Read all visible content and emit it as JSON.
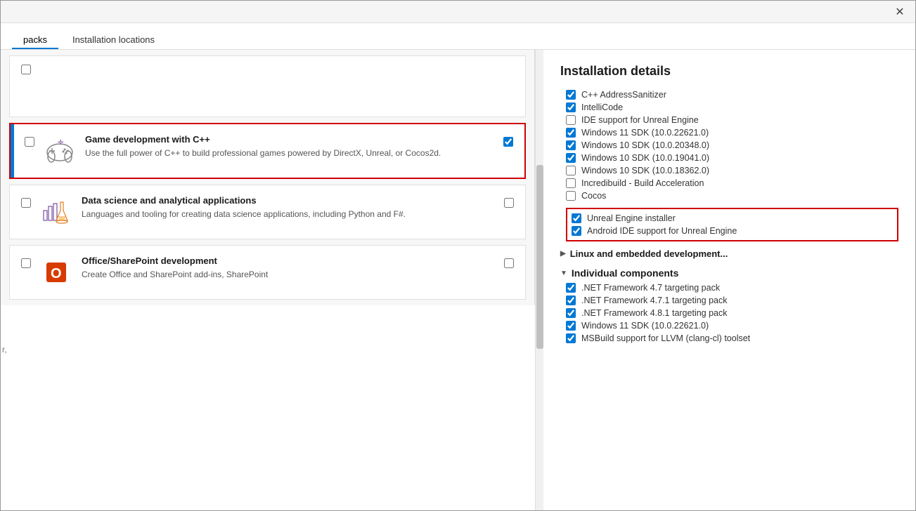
{
  "window": {
    "close_label": "✕"
  },
  "tabs": [
    {
      "id": "workloads",
      "label": "packs"
    },
    {
      "id": "locations",
      "label": "Installation locations"
    }
  ],
  "left_panel": {
    "items": [
      {
        "id": "empty-top",
        "type": "empty"
      },
      {
        "id": "game-dev",
        "type": "workload",
        "selected": true,
        "checked": true,
        "icon": "gamepad",
        "title": "Game development with C++",
        "description": "Use the full power of C++ to build professional games powered by DirectX, Unreal, or Cocos2d."
      },
      {
        "id": "data-science",
        "type": "workload",
        "selected": false,
        "checked": false,
        "icon": "datasci",
        "title": "Data science and analytical applications",
        "description": "Languages and tooling for creating data science applications, including Python and F#."
      },
      {
        "id": "office",
        "type": "workload",
        "selected": false,
        "checked": false,
        "icon": "office",
        "title": "Office/SharePoint development",
        "description": "Create Office and SharePoint add-ins, SharePoint"
      }
    ],
    "side_label": "r,"
  },
  "right_panel": {
    "title": "Installation details",
    "details": [
      {
        "id": "addresssanitizer",
        "label": "C++ AddressSanitizer",
        "checked": true
      },
      {
        "id": "intellicode",
        "label": "IntelliCode",
        "checked": true
      },
      {
        "id": "ide-unreal",
        "label": "IDE support for Unreal Engine",
        "checked": false
      },
      {
        "id": "win11-sdk",
        "label": "Windows 11 SDK (10.0.22621.0)",
        "checked": true
      },
      {
        "id": "win10-sdk1",
        "label": "Windows 10 SDK (10.0.20348.0)",
        "checked": true
      },
      {
        "id": "win10-sdk2",
        "label": "Windows 10 SDK (10.0.19041.0)",
        "checked": true
      },
      {
        "id": "win10-sdk3",
        "label": "Windows 10 SDK (10.0.18362.0)",
        "checked": false
      },
      {
        "id": "incredibuild",
        "label": "Incredibuild - Build Acceleration",
        "checked": false
      },
      {
        "id": "cocos",
        "label": "Cocos",
        "checked": false
      }
    ],
    "highlighted_items": [
      {
        "id": "unreal-installer",
        "label": "Unreal Engine installer",
        "checked": true
      },
      {
        "id": "android-ide",
        "label": "Android IDE support for Unreal Engine",
        "checked": true
      }
    ],
    "linux_section": {
      "label": "Linux and embedded development...",
      "collapsed": true
    },
    "individual_components": {
      "label": "Individual components",
      "collapsed": false,
      "items": [
        {
          "id": "net47",
          "label": ".NET Framework 4.7 targeting pack",
          "checked": true
        },
        {
          "id": "net471",
          "label": ".NET Framework 4.7.1 targeting pack",
          "checked": true
        },
        {
          "id": "net481",
          "label": ".NET Framework 4.8.1 targeting pack",
          "checked": true
        },
        {
          "id": "win11sdk2",
          "label": "Windows 11 SDK (10.0.22621.0)",
          "checked": true
        },
        {
          "id": "msbuild-llvm",
          "label": "MSBuild support for LLVM (clang-cl) toolset",
          "checked": true
        }
      ]
    }
  }
}
